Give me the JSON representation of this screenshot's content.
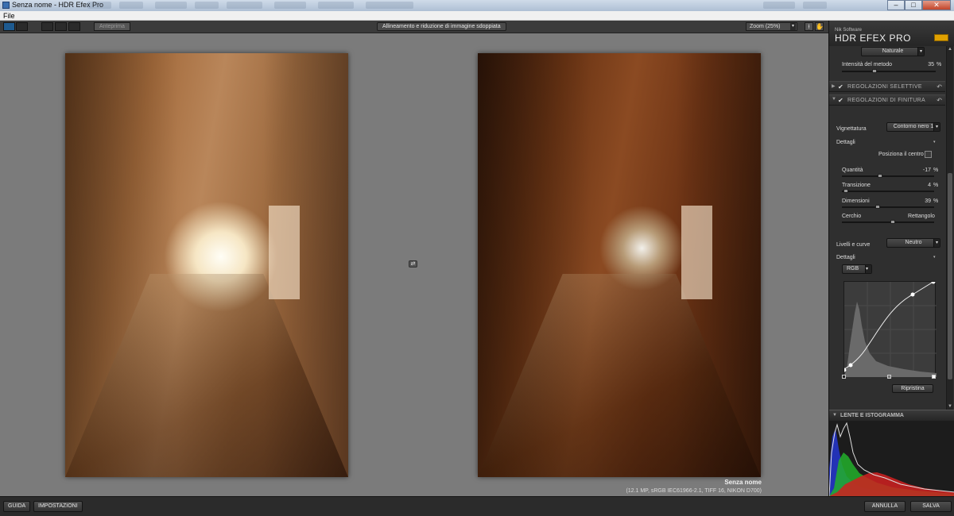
{
  "window": {
    "title": "Senza nome - HDR Efex Pro",
    "buttons": {
      "minimize": "–",
      "maximize": "□",
      "close": "✕"
    }
  },
  "menu": {
    "file": "File"
  },
  "toolbar": {
    "preview_btn": "Anteprima",
    "center_label": "Allineamento e riduzione di immagine sdoppiata",
    "zoom": "Zoom (25%)"
  },
  "canvas": {
    "image_name": "Senza nome",
    "image_info": "(12.1 MP, sRGB IEC61966-2.1, TIFF 16, NIKON D700)"
  },
  "bottom": {
    "guida": "GUIDA",
    "impostazioni": "IMPOSTAZIONI",
    "annulla": "ANNULLA",
    "salva": "SALVA"
  },
  "panel": {
    "brand_small": "Nik Software",
    "brand_product": "HDR EFEX PRO",
    "method_preset": "Naturale",
    "method_intensity_label": "Intensità del metodo",
    "method_intensity_value": "35",
    "section_selective": "REGOLAZIONI SELETTIVE",
    "section_finishing": "REGOLAZIONI DI FINITURA",
    "vignette_label": "Vignettatura",
    "vignette_preset": "Contorno nero 1",
    "dettagli_1": "Dettagli",
    "position_center": "Posiziona il centro",
    "amount_label": "Quantità",
    "amount_value": "-17",
    "transition_label": "Transizione",
    "transition_value": "4",
    "size_label": "Dimensioni",
    "size_value": "39",
    "circle_label": "Cerchio",
    "rect_label": "Rettangolo",
    "levels_label": "Livelli e curve",
    "levels_preset": "Neutro",
    "dettagli_2": "Dettagli",
    "channel": "RGB",
    "reset_btn": "Ripristina",
    "lens_section": "LENTE E ISTOGRAMMA",
    "percent": "%"
  },
  "sliders": {
    "method_intensity": 0.35,
    "amount": 0.41,
    "transition": 0.04,
    "size": 0.39,
    "shape": 0.55
  }
}
